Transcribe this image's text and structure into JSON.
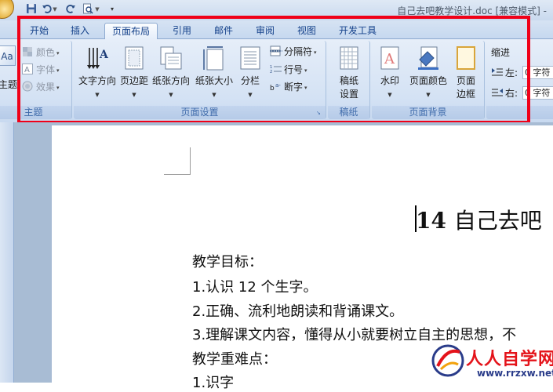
{
  "window": {
    "title": "自己去吧教学设计.doc [兼容模式] -"
  },
  "colors": {
    "highlight": "#f00018",
    "tab_text": "#15428b",
    "group_label": "#3e6aaa",
    "watermark_red": "#e4131a",
    "watermark_blue": "#2a3c8a"
  },
  "quick_access": {
    "icons": [
      "save-icon",
      "undo-icon",
      "redo-icon",
      "print-preview-icon",
      "customize-arrow-icon"
    ]
  },
  "tabs": [
    {
      "label": "开始",
      "active": false
    },
    {
      "label": "插入",
      "active": false
    },
    {
      "label": "页面布局",
      "active": true
    },
    {
      "label": "引用",
      "active": false
    },
    {
      "label": "邮件",
      "active": false
    },
    {
      "label": "审阅",
      "active": false
    },
    {
      "label": "视图",
      "active": false
    },
    {
      "label": "开发工具",
      "active": false
    }
  ],
  "ribbon": {
    "theme_group": {
      "label": "主题",
      "themes_button": "主题",
      "colors": "颜色",
      "fonts": "字体",
      "effects": "效果"
    },
    "page_setup_group": {
      "label": "页面设置",
      "text_direction": "文字方向",
      "margins": "页边距",
      "orientation": "纸张方向",
      "size": "纸张大小",
      "columns": "分栏",
      "breaks": "分隔符",
      "line_numbers": "行号",
      "hyphenation": "断字"
    },
    "draft_group": {
      "label": "稿纸",
      "draft_setup_line1": "稿纸",
      "draft_setup_line2": "设置"
    },
    "page_background_group": {
      "label": "页面背景",
      "watermark": "水印",
      "page_color": "页面颜色",
      "page_borders_line1": "页面",
      "page_borders_line2": "边框"
    },
    "paragraph_group": {
      "indent_label": "缩进",
      "left_label": "左:",
      "left_value": "0 字符",
      "right_label": "右:",
      "right_value": "0 字符"
    }
  },
  "document": {
    "title_number": "14",
    "title_text": "自己去吧",
    "lines": [
      "教学目标：",
      "1.认识 12 个生字。",
      "2.正确、流利地朗读和背诵课文。",
      "3.理解课文内容，懂得从小就要树立自主的思想，不",
      "教学重难点：",
      "1.识字"
    ]
  },
  "watermark": {
    "name": "人人自学网",
    "url": "www.rrzxw.net"
  }
}
